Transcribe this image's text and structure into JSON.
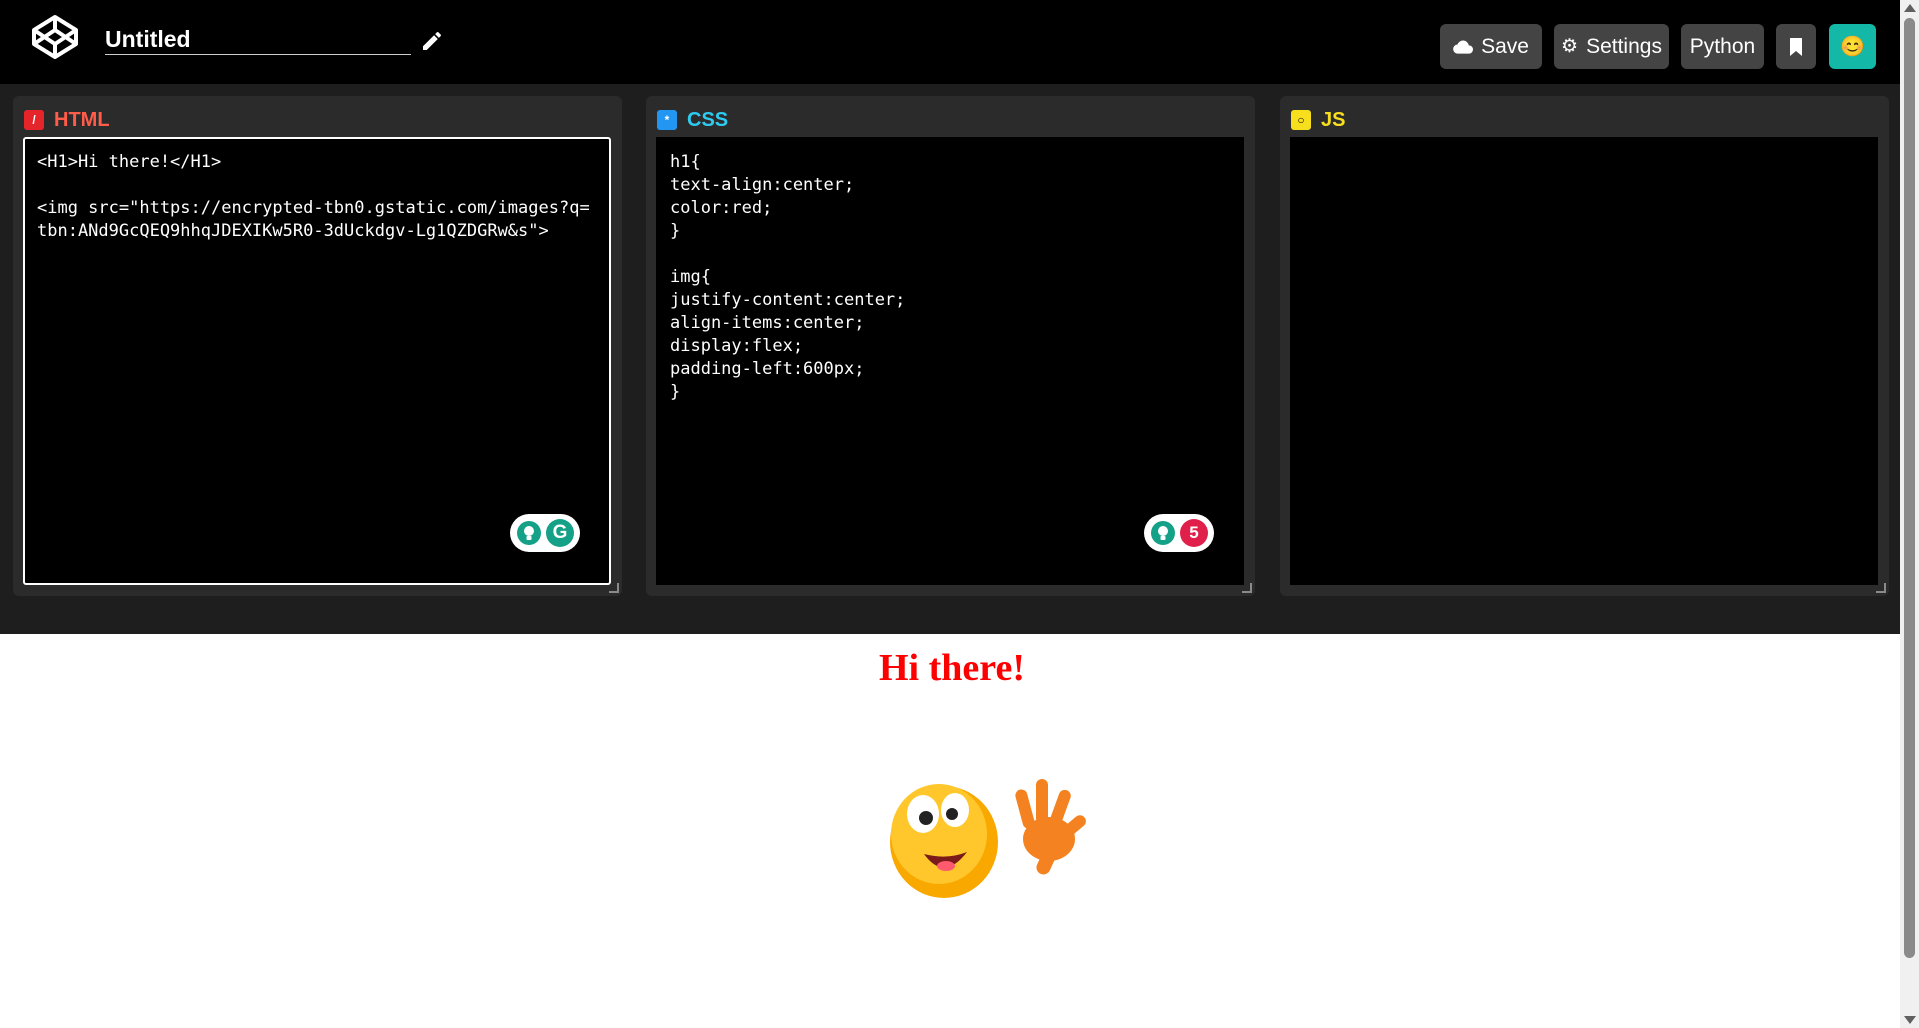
{
  "header": {
    "title": "Untitled",
    "buttons": {
      "save": "Save",
      "settings": "Settings",
      "language": "Python",
      "avatar_emoji": "😊"
    },
    "icons": [
      "codepen-logo-icon",
      "pencil-icon",
      "cloud-icon",
      "gear-icon",
      "bookmark-icon"
    ]
  },
  "panes": {
    "html": {
      "label": "HTML",
      "code": "<H1>Hi there!</H1>\n\n<img src=\"https://encrypted-tbn0.gstatic.com/images?q=tbn:ANd9GcQEQ9hhqJDEXIKw5R0-3dUckdgv-Lg1QZDGRw&s\">",
      "color": "#e5252a"
    },
    "css": {
      "label": "CSS",
      "code": "h1{\ntext-align:center;\ncolor:red;\n}\n\nimg{\njustify-content:center;\nalign-items:center;\ndisplay:flex;\npadding-left:600px;\n}",
      "grammar_count": "5",
      "color": "#2196f3"
    },
    "js": {
      "label": "JS",
      "code": "",
      "color": "#f7df1e"
    }
  },
  "preview": {
    "heading": "Hi there!",
    "heading_color": "#ff0000"
  }
}
